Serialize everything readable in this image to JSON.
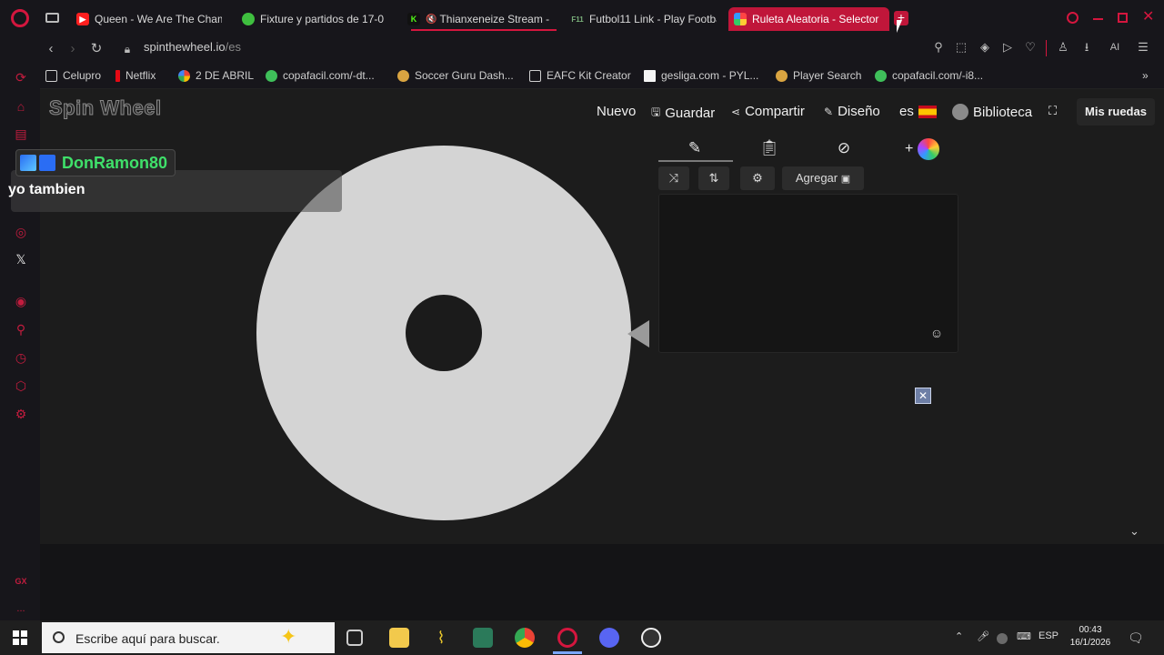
{
  "browser": {
    "tabs": [
      {
        "title": "Queen - We Are The Cham",
        "color": "#ff1f1f"
      },
      {
        "title": "Fixture y partidos de 17-0",
        "color": "#3fbf3f"
      },
      {
        "title": "Thianxeneize Stream -",
        "color": "#53fc18",
        "muted": "🔇"
      },
      {
        "title": "Futbol11 Link - Play Footba",
        "color": "#7ab07a",
        "prefix": "F11"
      },
      {
        "title": "Ruleta Aleatoria - Selector",
        "color": "#e8416f"
      }
    ],
    "new_tab": "+",
    "url_host": "spinthewheel.io",
    "url_path": "/es",
    "ai_label": "AI"
  },
  "bookmarks": [
    {
      "label": "Celupro",
      "color": "#cfcfcf"
    },
    {
      "label": "Netflix",
      "color": "#e50914"
    },
    {
      "label": "2 DE ABRIL",
      "color": "#4285f4"
    },
    {
      "label": "copafacil.com/-dt...",
      "color": "#3fbf5a"
    },
    {
      "label": "Soccer Guru Dash...",
      "color": "#d9a441"
    },
    {
      "label": "EAFC Kit Creator",
      "color": "#cfcfcf"
    },
    {
      "label": "gesliga.com - PYL...",
      "color": "#f5f5f5"
    },
    {
      "label": "Player Search",
      "color": "#d9a441"
    },
    {
      "label": "copafacil.com/-i8...",
      "color": "#3fbf5a"
    }
  ],
  "site": {
    "logo": "Spin Wheel",
    "nav": {
      "nuevo": "Nuevo",
      "guardar": "Guardar",
      "compartir": "Compartir",
      "diseno": "Diseño",
      "lang": "es",
      "biblioteca": "Biblioteca",
      "mis_ruedas": "Mis ruedas"
    },
    "editor": {
      "agregar": "Agregar"
    }
  },
  "stream_overlay": {
    "username": "DonRamon80",
    "message": "yo tambien"
  },
  "taskbar": {
    "search_placeholder": "Escribe aquí para buscar.",
    "lang": "ESP",
    "time": "00:43",
    "date": "16/1/2026"
  },
  "sidebar": {
    "gx_label": "GX",
    "more": "..."
  }
}
